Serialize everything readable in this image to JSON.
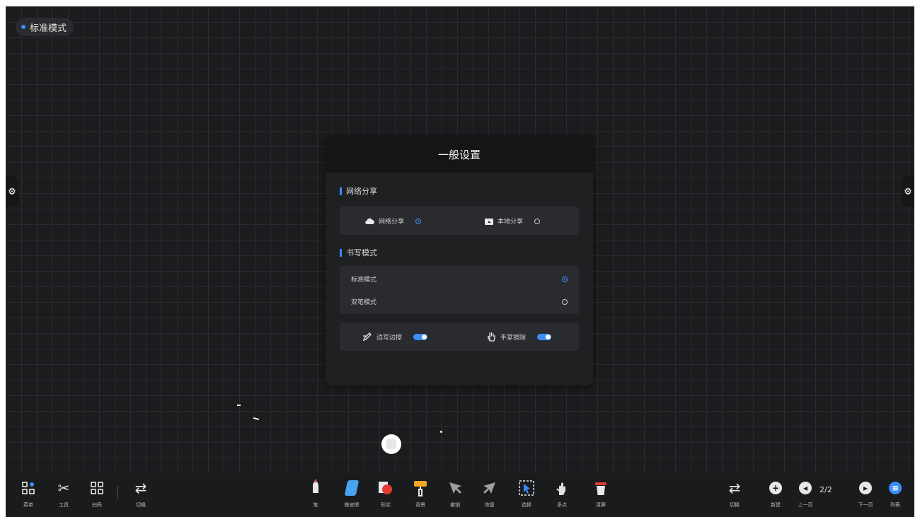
{
  "mode_chip": {
    "label": "标准模式"
  },
  "side_tabs": {
    "icon": "gear-icon"
  },
  "dialog": {
    "title": "一般设置",
    "share_section": {
      "title": "网络分享",
      "options": [
        {
          "label": "网络分享",
          "icon": "cloud-icon",
          "selected": true
        },
        {
          "label": "本地分享",
          "icon": "folder-icon",
          "selected": false
        }
      ]
    },
    "writing_section": {
      "title": "书写模式",
      "options": [
        {
          "label": "标准模式",
          "selected": true
        },
        {
          "label": "双笔模式",
          "selected": false
        }
      ]
    },
    "toggles": [
      {
        "label": "边写边擦",
        "icon": "pen-hand-icon",
        "on": true
      },
      {
        "label": "手掌擦除",
        "icon": "palm-icon",
        "on": true
      }
    ]
  },
  "toolbar": {
    "left": [
      {
        "label": "菜单",
        "icon": "apps-icon"
      },
      {
        "label": "工具",
        "icon": "tools-icon"
      },
      {
        "label": "扫码",
        "icon": "qr-icon"
      },
      {
        "label": "切换",
        "icon": "switch-icon"
      }
    ],
    "center": [
      {
        "label": "笔",
        "icon": "pen-icon",
        "color": "#e53935"
      },
      {
        "label": "橡皮擦",
        "icon": "eraser-icon",
        "color": "#4aa3f0"
      },
      {
        "label": "形状",
        "icon": "shape-icon",
        "color": "#e53935"
      },
      {
        "label": "背景",
        "icon": "roller-icon",
        "color": "#f5a623"
      },
      {
        "label": "撤销",
        "icon": "undo-icon",
        "color": "#9e9e9e"
      },
      {
        "label": "恢复",
        "icon": "redo-icon",
        "color": "#9e9e9e"
      },
      {
        "label": "选择",
        "icon": "select-icon",
        "color": "#3a8df5"
      },
      {
        "label": "多点",
        "icon": "multitouch-icon",
        "color": "#e0e0e0"
      },
      {
        "label": "清屏",
        "icon": "trash-icon",
        "color": "#e53935"
      }
    ],
    "right": [
      {
        "label": "切换",
        "icon": "switch-icon"
      },
      {
        "label": "新建",
        "icon": "plus-icon"
      },
      {
        "label": "上一页",
        "icon": "prev-icon"
      },
      {
        "label": "下一页",
        "icon": "next-icon"
      },
      {
        "label": "列表",
        "icon": "list-icon"
      }
    ],
    "page_indicator": "2/2"
  }
}
